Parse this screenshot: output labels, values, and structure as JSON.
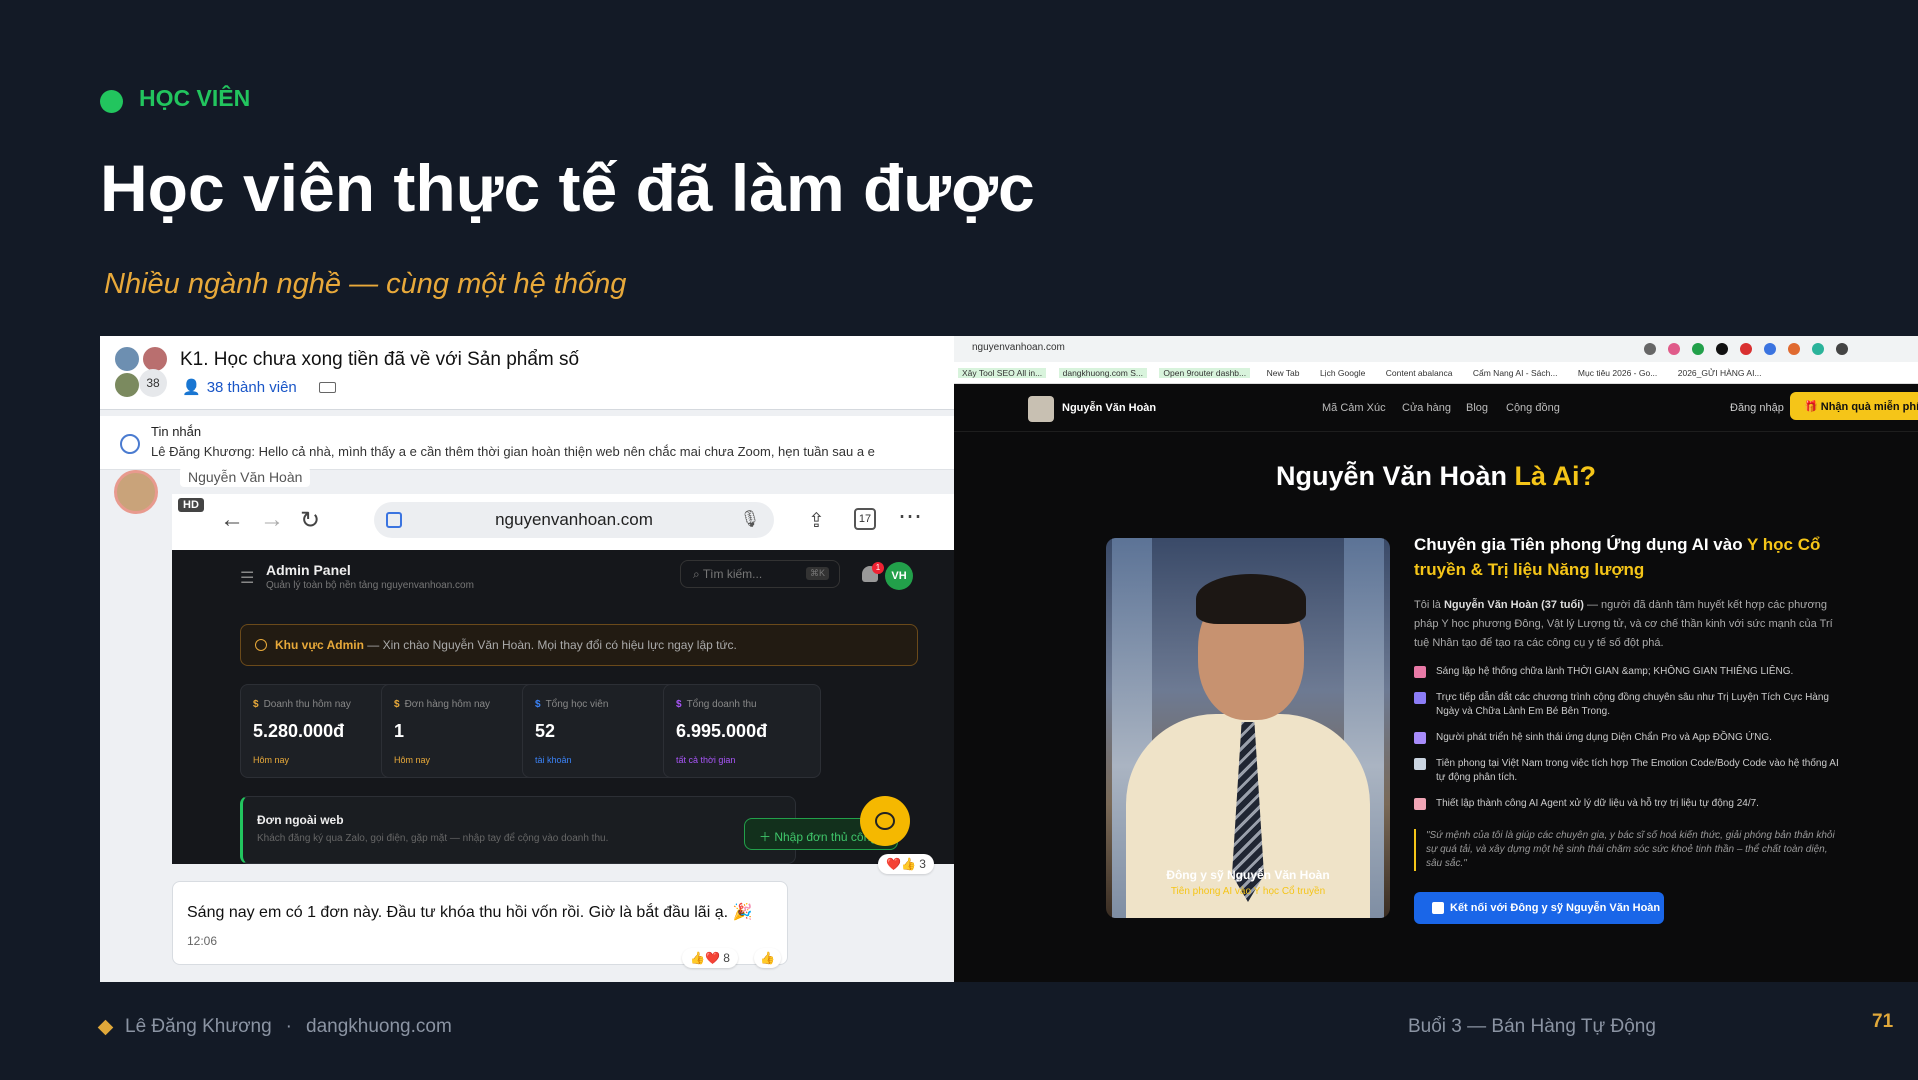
{
  "slide": {
    "tag": "HỌC VIÊN",
    "title": "Học viên thực tế đã làm được",
    "subtitle": "Nhiều ngành nghề — cùng một hệ thống",
    "footer_author": "Lê Đăng Khương",
    "footer_sep": "·",
    "footer_site": "dangkhuong.com",
    "footer_session": "Buổi 3 — Bán Hàng Tự Động",
    "page_number": "71"
  },
  "chat": {
    "group_title": "K1. Học chưa xong tiền đã về với Sản phẩm số",
    "avatar_count": "38",
    "members": "38 thành viên",
    "pinned_label": "Tin nhắn",
    "pinned_message": "Lê Đăng Khương: Hello cả nhà, mình thấy a e cần thêm thời gian hoàn thiện web nên chắc mai chưa Zoom, hẹn tuần sau a e",
    "sender": "Nguyễn Văn Hoàn",
    "hd_label": "HD",
    "screenshot": {
      "url": "nguyenvanhoan.com",
      "tabs_count": "17",
      "admin_title": "Admin Panel",
      "admin_subtitle": "Quản lý toàn bộ nền tảng nguyenvanhoan.com",
      "search_placeholder": "Tìm kiếm...",
      "search_shortcut": "⌘K",
      "notif_count": "1",
      "user_initials": "VH",
      "alert_strong": "Khu vực Admin",
      "alert_text": " — Xin chào Nguyễn Văn Hoàn. Mọi thay đổi có hiệu lực ngay lập tức.",
      "stats": [
        {
          "label": "Doanh thu hôm nay",
          "value": "5.280.000đ",
          "sub": "Hôm nay",
          "color": "#e8a93a"
        },
        {
          "label": "Đơn hàng hôm nay",
          "value": "1",
          "sub": "Hôm nay",
          "color": "#e8a93a"
        },
        {
          "label": "Tổng học viên",
          "value": "52",
          "sub": "tài khoản",
          "color": "#3b82f6"
        },
        {
          "label": "Tổng doanh thu",
          "value": "6.995.000đ",
          "sub": "tất cả thời gian",
          "color": "#a855f7"
        }
      ],
      "offweb_title": "Đơn ngoài web",
      "offweb_desc": "Khách đăng ký qua Zalo, gọi điện, gặp mặt — nhập tay để cộng vào doanh thu.",
      "offweb_button": "Nhập đơn thủ công"
    },
    "reaction_count_1": "3",
    "message_text": "Sáng nay em có 1 đơn này. Đầu tư khóa thu hồi vốn rồi. Giờ là bắt đầu lãi ạ. 🎉",
    "message_time": "12:06",
    "reaction_count_2": "8"
  },
  "website": {
    "url": "nguyenvanhoan.com",
    "bookmarks": [
      "Xây Tool SEO All in...",
      "dangkhuong.com S...",
      "Open 9router dashb...",
      "New Tab",
      "Lịch Google",
      "Content abalanca",
      "Cẩm Nang AI - Sách...",
      "Mục tiêu 2026 - Go...",
      "2026_GỬI HÀNG AI..."
    ],
    "brand": "Nguyễn Văn Hoàn",
    "nav": [
      "Mã Cảm Xúc",
      "Cửa hàng",
      "Blog",
      "Cộng đồng"
    ],
    "login": "Đăng nhập",
    "cta": "Nhận quà miễn phí",
    "hero_name": "Nguyễn Văn Hoàn ",
    "hero_accent": "Là Ai?",
    "photo_caption": "Đông y sỹ Nguyễn Văn Hoàn",
    "photo_sub": "Tiên phong AI vào Y học Cổ truyền",
    "headline_a": "Chuyên gia Tiên phong Ứng dụng AI vào ",
    "headline_b": "Y học Cổ truyền & Trị liệu Năng lượng",
    "intro_a": "Tôi là ",
    "intro_name": "Nguyễn Văn Hoàn (37 tuổi)",
    "intro_b": " — người đã dành tâm huyết kết hợp các phương pháp Y học phương Đông, Vật lý Lượng tử, và cơ chế thần kinh với sức mạnh của Trí tuệ Nhân tạo để tạo ra các công cụ y tế số đột phá.",
    "bullets": [
      {
        "text": "Sáng lập hệ thống chữa lành THỜI GIAN &amp; KHÔNG GIAN THIÊNG LIÊNG.",
        "color": "#e879a6"
      },
      {
        "text": "Trực tiếp dẫn dắt các chương trình cộng đồng chuyên sâu như Trị Luyện Tích Cực Hàng Ngày và Chữa Lành Em Bé Bên Trong.",
        "color": "#8b7cf6"
      },
      {
        "text": "Người phát triển hệ sinh thái ứng dụng Diện Chẩn Pro và App ĐỒNG ỨNG.",
        "color": "#a78bfa"
      },
      {
        "text": "Tiên phong tại Việt Nam trong việc tích hợp The Emotion Code/Body Code vào hệ thống AI tự động phân tích.",
        "color": "#cbd5e1"
      },
      {
        "text": "Thiết lập thành công AI Agent xử lý dữ liệu và hỗ trợ trị liệu tự động 24/7.",
        "color": "#f1a5b5"
      }
    ],
    "quote": "\"Sứ mệnh của tôi là giúp các chuyên gia, y bác sĩ số hoá kiến thức, giải phóng bản thân khỏi sự quá tải, và xây dựng một hệ sinh thái chăm sóc sức khoẻ tinh thần – thể chất toàn diện, sâu sắc.\"",
    "connect": "Kết nối với Đông y sỹ Nguyễn Văn Hoàn"
  }
}
